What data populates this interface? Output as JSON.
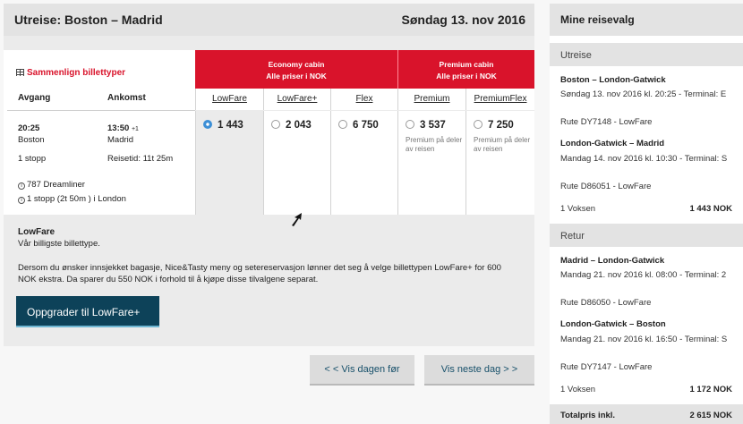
{
  "header": {
    "title": "Utreise:  Boston – Madrid",
    "date": "Søndag 13. nov 2016"
  },
  "compare_link": "Sammenlign billettyper",
  "columns": {
    "departure": "Avgang",
    "arrival": "Ankomst"
  },
  "cabins": [
    {
      "line1": "Economy cabin",
      "line2": "Alle priser i NOK"
    },
    {
      "line1": "Premium cabin",
      "line2": "Alle priser i NOK"
    }
  ],
  "fares": [
    {
      "name": "LowFare",
      "price": "1 443",
      "note": "",
      "selected": true
    },
    {
      "name": "LowFare+",
      "price": "2 043",
      "note": "",
      "selected": false
    },
    {
      "name": "Flex",
      "price": "6 750",
      "note": "",
      "selected": false
    },
    {
      "name": "Premium",
      "price": "3 537",
      "note": "Premium på deler av reisen",
      "selected": false
    },
    {
      "name": "PremiumFlex",
      "price": "7 250",
      "note": "Premium på deler av reisen",
      "selected": false
    }
  ],
  "flight": {
    "dep_time": "20:25",
    "dep_city": "Boston",
    "arr_time": "13:50",
    "arr_plus": "+1",
    "arr_city": "Madrid",
    "stops": "1 stopp",
    "travel_time": "Reisetid: 11t 25m",
    "aircraft": "787 Dreamliner",
    "stop_info": "1 stopp (2t 50m ) i London"
  },
  "fare_info": {
    "title": "LowFare",
    "subtitle": "Vår billigste billettype.",
    "text": "Dersom du ønsker innsjekket bagasje, Nice&Tasty meny og setereservasjon lønner det seg å velge billettypen LowFare+ for 600 NOK ekstra. Da sparer du 550 NOK i forhold til å kjøpe disse tilvalgene separat.",
    "upgrade_label": "Oppgrader til LowFare+"
  },
  "nav": {
    "prev": "< < Vis dagen før",
    "next": "Vis neste dag > >"
  },
  "sidebar": {
    "title": "Mine reisevalg",
    "outbound_title": "Utreise",
    "outbound": [
      {
        "route": "Boston – London-Gatwick",
        "detail": "Søndag 13. nov 2016 kl. 20:25 - Terminal: E",
        "flight": "Rute DY7148 - LowFare"
      },
      {
        "route": "London-Gatwick – Madrid",
        "detail": "Mandag 14. nov 2016 kl. 10:30 - Terminal: S",
        "flight": "Rute D86051 - LowFare"
      }
    ],
    "outbound_pax": "1 Voksen",
    "outbound_price": "1 443 NOK",
    "return_title": "Retur",
    "return": [
      {
        "route": "Madrid – London-Gatwick",
        "detail": "Mandag 21. nov 2016 kl. 08:00 - Terminal: 2",
        "flight": "Rute D86050 - LowFare"
      },
      {
        "route": "London-Gatwick – Boston",
        "detail": "Mandag 21. nov 2016 kl. 16:50 - Terminal: S",
        "flight": "Rute DY7147 - LowFare"
      }
    ],
    "return_pax": "1 Voksen",
    "return_price": "1 172 NOK",
    "total_label": "Totalpris inkl.",
    "total_price": "2 615 NOK"
  },
  "colors": {
    "brand_red": "#d9132b",
    "button_navy": "#0d4259",
    "radio_blue": "#3c8fd6"
  }
}
